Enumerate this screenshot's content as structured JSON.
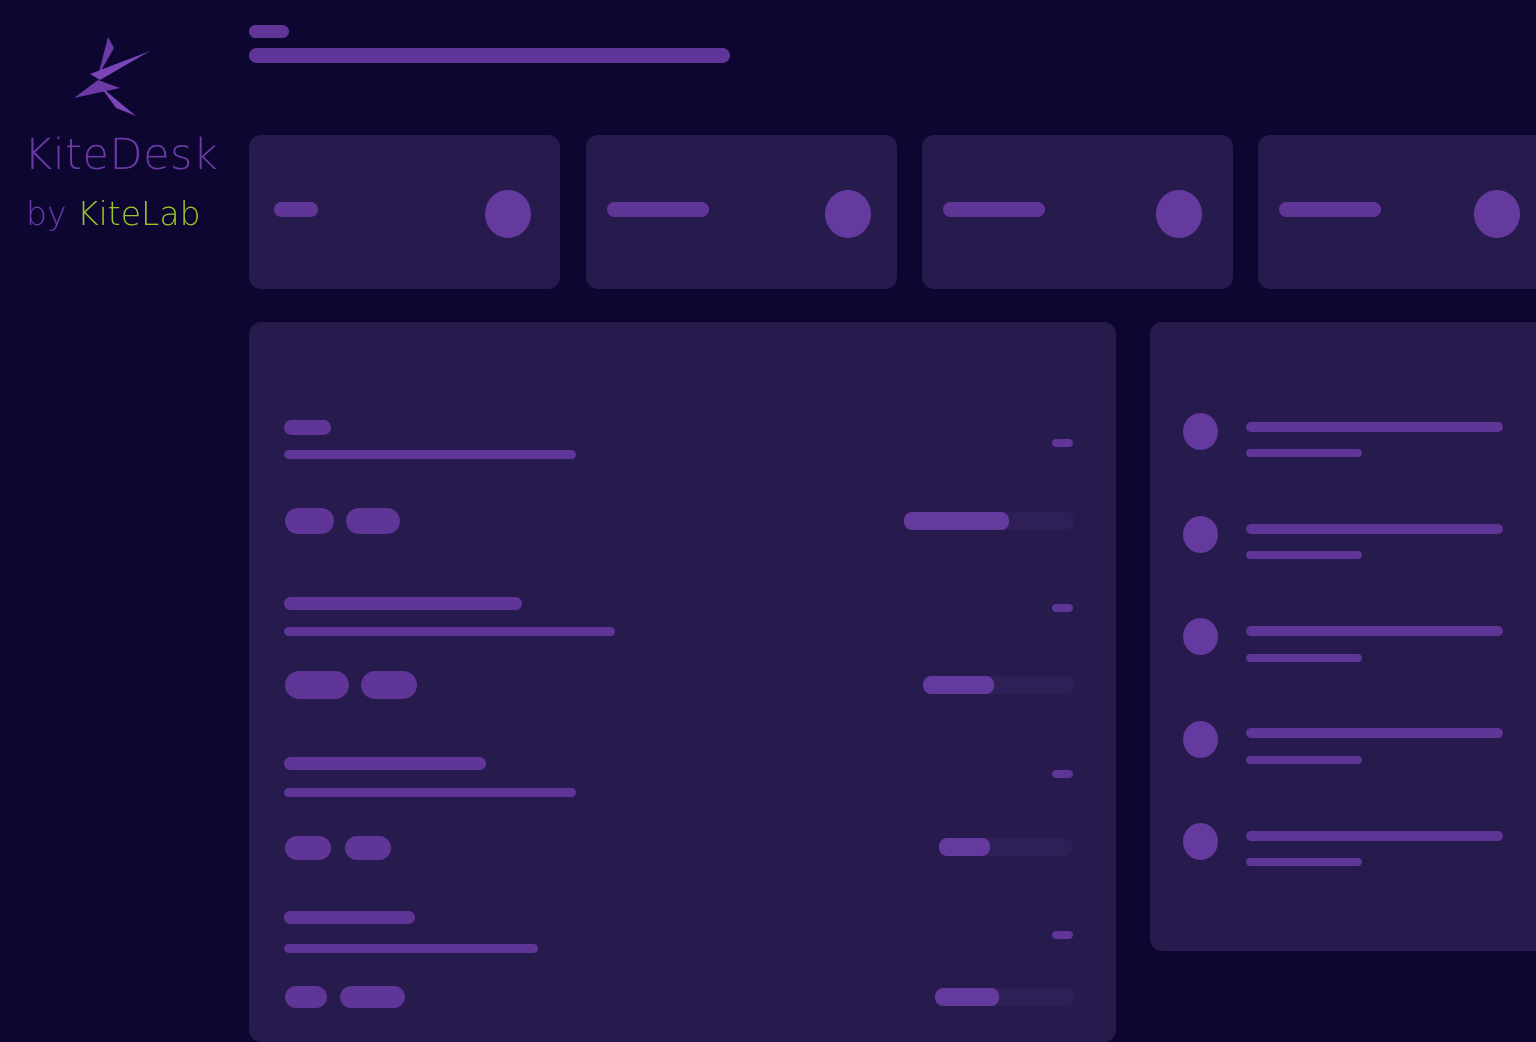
{
  "brand": {
    "name": "KiteDesk",
    "by": "by",
    "company": "KiteLab",
    "icon": "kite-logo-icon"
  },
  "colors": {
    "background": "#0c0630",
    "card": "#271a4d",
    "placeholder": "#5f3597",
    "brand_purple": "#6b3aa5",
    "brand_lime": "#9cc628"
  },
  "tasks": [
    {
      "progress": 0.62
    },
    {
      "progress": 0.47
    },
    {
      "progress": 0.38
    },
    {
      "progress": 0.46
    }
  ]
}
